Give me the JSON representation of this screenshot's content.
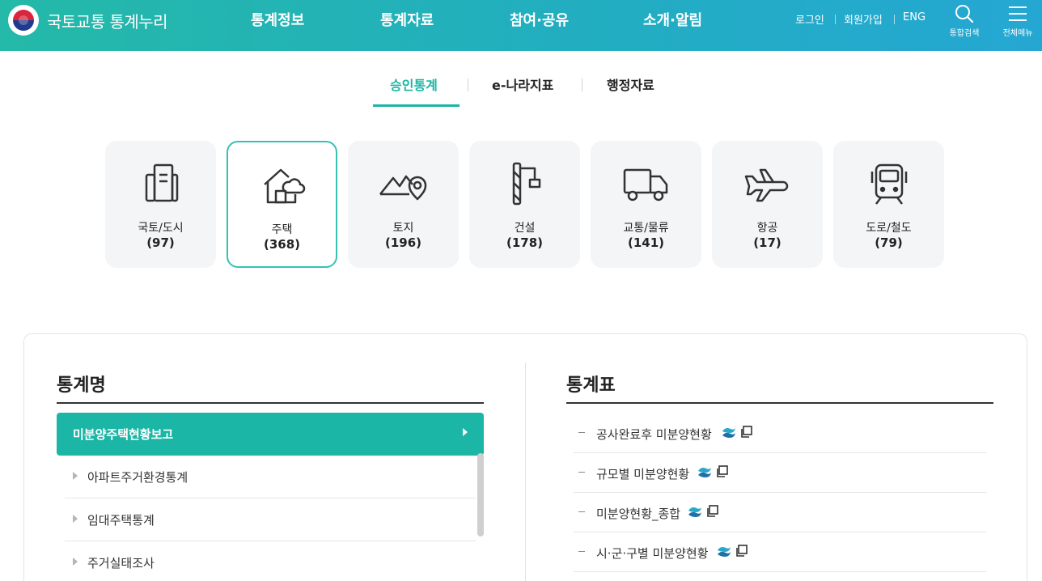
{
  "header": {
    "site_title": "국토교통 통계누리",
    "nav": [
      "통계정보",
      "통계자료",
      "참여·공유",
      "소개·알림"
    ],
    "util_links": [
      "로그인",
      "회원가입",
      "ENG"
    ],
    "search_caption": "통합검색",
    "menu_caption": "전체메뉴",
    "brand_color": "#24b9a8"
  },
  "tabs": [
    {
      "label": "승인통계",
      "active": true
    },
    {
      "label": "e-나라지표",
      "active": false
    },
    {
      "label": "행정자료",
      "active": false
    }
  ],
  "categories": [
    {
      "label": "국토/도시",
      "count": "(97)",
      "icon": "building-icon"
    },
    {
      "label": "주택",
      "count": "(368)",
      "icon": "house-icon",
      "selected": true
    },
    {
      "label": "토지",
      "count": "(196)",
      "icon": "land-pin-icon"
    },
    {
      "label": "건설",
      "count": "(178)",
      "icon": "crane-icon"
    },
    {
      "label": "교통/물류",
      "count": "(141)",
      "icon": "truck-icon"
    },
    {
      "label": "항공",
      "count": "(17)",
      "icon": "airplane-icon"
    },
    {
      "label": "도로/철도",
      "count": "(79)",
      "icon": "train-icon"
    }
  ],
  "stats": {
    "title": "통계명",
    "active_item": "미분양주택현황보고",
    "items": [
      "아파트주거환경통계",
      "임대주택통계",
      "주거실태조사"
    ]
  },
  "tables": {
    "title": "통계표",
    "items": [
      "공사완료후 미분양현황",
      "규모별 미분양현황",
      "미분양현황_종합",
      "시·군·구별 미분양현황"
    ]
  },
  "colors": {
    "accent": "#1bb6a6",
    "card_bg": "#f3f5f7"
  }
}
